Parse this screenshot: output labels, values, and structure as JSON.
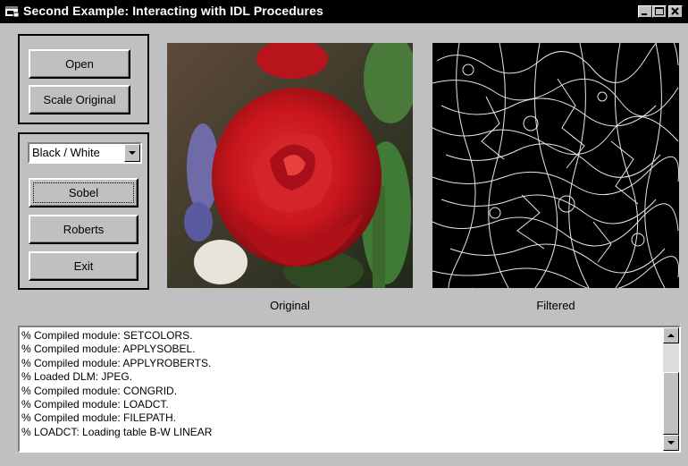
{
  "window": {
    "title": "Second Example: Interacting with IDL Procedures"
  },
  "buttons": {
    "open": "Open",
    "scale_original": "Scale Original",
    "sobel": "Sobel",
    "roberts": "Roberts",
    "exit": "Exit"
  },
  "colortable": {
    "selected": "Black / White"
  },
  "images": {
    "original_caption": "Original",
    "filtered_caption": "Filtered"
  },
  "log": {
    "lines": [
      "% Compiled module: SETCOLORS.",
      "% Compiled module: APPLYSOBEL.",
      "% Compiled module: APPLYROBERTS.",
      "% Loaded DLM: JPEG.",
      "% Compiled module: CONGRID.",
      "% Compiled module: LOADCT.",
      "% Compiled module: FILEPATH.",
      "% LOADCT: Loading table B-W LINEAR"
    ]
  },
  "colors": {
    "titlebar": "#000000",
    "face": "#c0c0c0"
  },
  "icons": {
    "window": "app-window-icon",
    "minimize": "minimize-icon",
    "maximize": "maximize-icon",
    "close": "close-icon",
    "dropdown": "chevron-down-icon",
    "scroll_up": "arrow-up-icon",
    "scroll_down": "arrow-down-icon"
  }
}
